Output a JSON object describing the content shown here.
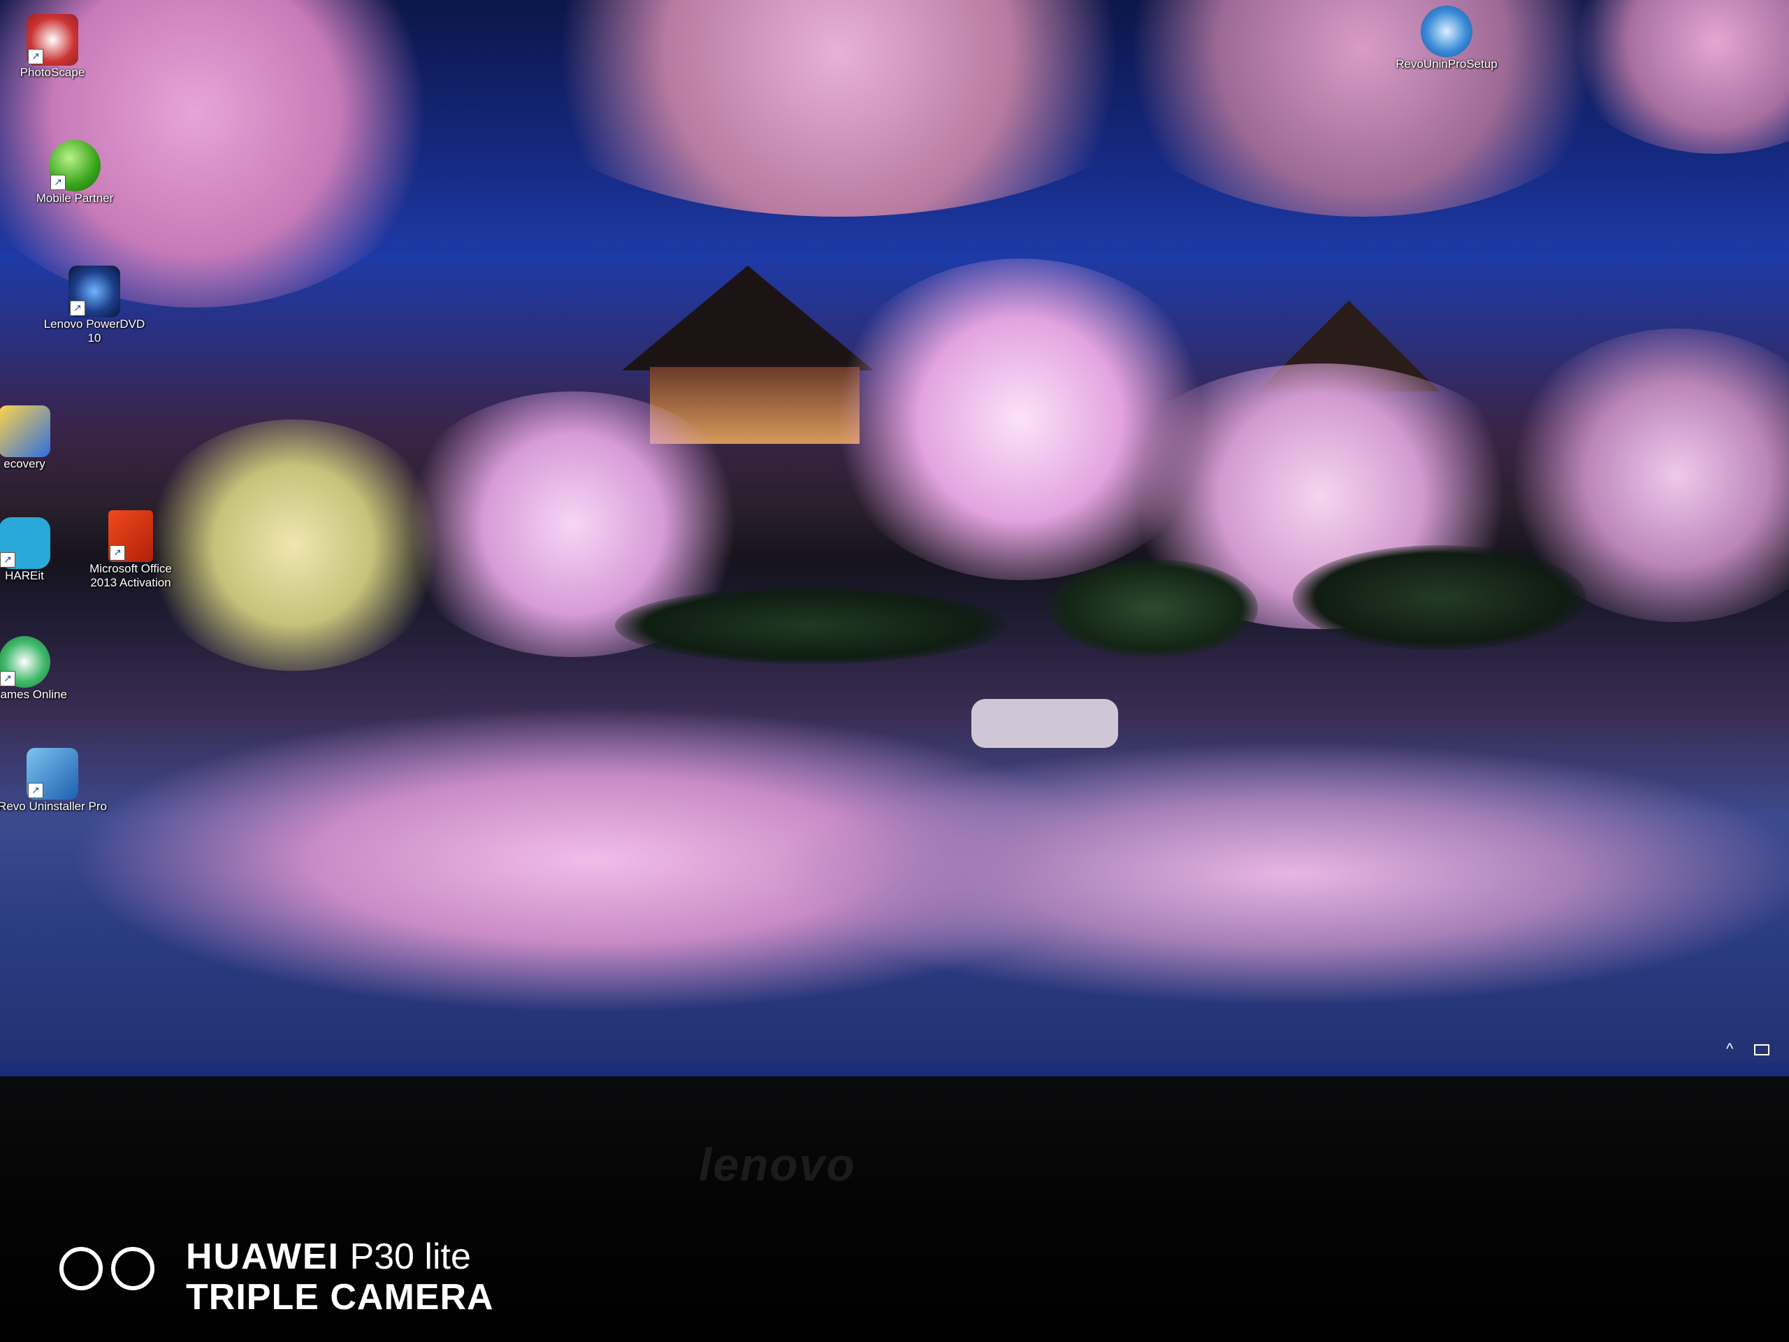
{
  "desktop": {
    "icons": [
      {
        "label": "PhotoScape",
        "icon": "photoscape-icon"
      },
      {
        "label": "Mobile Partner",
        "icon": "mobile-partner-icon"
      },
      {
        "label": "Lenovo PowerDVD 10",
        "icon": "powerdvd-icon"
      },
      {
        "label": "ecovery",
        "icon": "recovery-icon"
      },
      {
        "label": "HAREit",
        "icon": "shareit-icon"
      },
      {
        "label": "Microsoft Office 2013 Activation",
        "icon": "office-icon"
      },
      {
        "label": "y Games Online",
        "icon": "games-icon"
      },
      {
        "label": "Revo Uninstaller Pro",
        "icon": "revo-uninstaller-icon"
      },
      {
        "label": "RevoUninProSetup",
        "icon": "revo-setup-icon"
      }
    ]
  },
  "taskbar": {
    "pinned": [
      "internet-explorer-icon",
      "file-explorer-icon",
      "chrome-icon",
      "app-icon",
      "app-icon-2",
      "app-icon-3",
      "edge-icon"
    ],
    "tray": [
      "chevron-up-icon",
      "network-icon"
    ]
  },
  "bezel": {
    "brand": "lenovo"
  },
  "watermark": {
    "brand": "HUAWEI",
    "model": "P30 lite",
    "line2": "TRIPLE CAMERA"
  },
  "colors": {
    "taskbar": "#16287a",
    "sky": "#1e3aa6",
    "blossom": "#f0a8e8"
  }
}
